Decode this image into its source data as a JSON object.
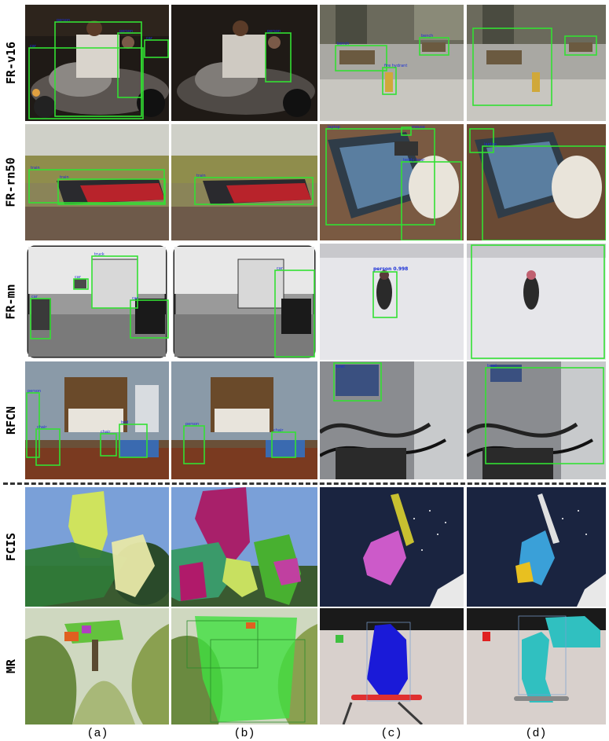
{
  "row_labels": [
    "FR-v16",
    "FR-rn50",
    "FR-mn",
    "RFCN",
    "FCIS",
    "MR"
  ],
  "column_labels": [
    "(a)",
    "(b)",
    "(c)",
    "(d)"
  ],
  "detections": {
    "r0c0": [
      "car",
      "person",
      "person",
      "car"
    ],
    "r0c1": [
      "person"
    ],
    "r0c2": [
      "bench",
      "bench",
      "fire hydrant"
    ],
    "r1c0": [
      "train",
      "train"
    ],
    "r1c1": [
      "train"
    ],
    "r1c2": [
      "laptop",
      "mouse",
      "teddy bear"
    ],
    "r1c3": [
      "laptop"
    ],
    "r2c0": [
      "car",
      "truck",
      "car",
      "car"
    ],
    "r2c1": [
      "car"
    ],
    "r2c2": [
      "person 0.998"
    ],
    "r3c0": [
      "person",
      "chair",
      "chair",
      "bed"
    ],
    "r3c1": [
      "person",
      "chair"
    ],
    "r3c2": [
      "bowl"
    ],
    "r3c3": [
      "bowl"
    ]
  },
  "colors": {
    "box": "#33e033",
    "label": "#1a2fd6",
    "divider": "#333333"
  }
}
